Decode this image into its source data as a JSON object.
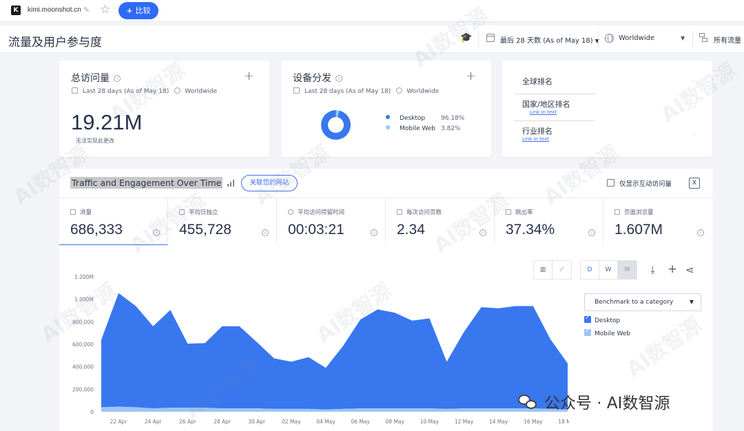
{
  "browser": {
    "site_initial": "K",
    "site_name": "kimi.moonshot.cn",
    "compare_label": "比较"
  },
  "header": {
    "title": "流量及用户参与度",
    "date_range": "最后 28 天数 (As of May 18)",
    "region": "Worldwide",
    "traffic_type": "所有流量"
  },
  "visits_card": {
    "title": "总访问量",
    "period": "Last 28 days (As of May 18)",
    "region": "Worldwide",
    "value": "19.21M",
    "note": "无法实现此更改"
  },
  "device_card": {
    "title": "设备分发",
    "period": "Last 28 days (As of May 18)",
    "region": "Worldwide",
    "desktop_label": "Desktop",
    "desktop_pct": "96.18%",
    "mobile_label": "Mobile Web",
    "mobile_pct": "3.82%",
    "desktop_share": 96.18,
    "mobile_share": 3.82,
    "desktop_color": "#3977ef",
    "mobile_color": "#8ccaf7"
  },
  "rank_card": {
    "global_rank": "全球排名",
    "country_rank": "国家/地区排名",
    "country_link": "Link in text",
    "industry_rank": "行业排名",
    "industry_link": "Link in text",
    "global_value": "-",
    "country_value": "-",
    "industry_value": "-"
  },
  "section": {
    "title": "Traffic and Engagement Over Time",
    "connect_label": "关联您的网站",
    "checkbox_label": "仅显示互动访问量",
    "excel_icon": "excel-icon"
  },
  "metrics": [
    {
      "label": "流量",
      "value": "686,333"
    },
    {
      "label": "平均日独立",
      "value": "455,728"
    },
    {
      "label": "平均访问停留时间",
      "value": "00:03:21"
    },
    {
      "label": "每次访问页数",
      "value": "2.34"
    },
    {
      "label": "跳出率",
      "value": "37.34%"
    },
    {
      "label": "页面浏览量",
      "value": "1.607M"
    }
  ],
  "toolbar": {
    "granularity": [
      "D",
      "W",
      "M"
    ],
    "granularity_selected": "M",
    "benchmark_label": "Benchmark to a category",
    "series_desktop": "Desktop",
    "series_mobile": "Mobile Web"
  },
  "chart_data": {
    "type": "area",
    "stacked": true,
    "y_ticks": [
      "0",
      "200,000",
      "400,000",
      "600,000",
      "800,000",
      "1.000M",
      "1.200M"
    ],
    "ylim": [
      0,
      1200000
    ],
    "x_tick_labels": [
      "22 Apr",
      "24 Apr",
      "26 Apr",
      "28 Apr",
      "30 Apr",
      "02 May",
      "04 May",
      "06 May",
      "08 May",
      "10 May",
      "12 May",
      "14 May",
      "16 May",
      "18 May"
    ],
    "x": [
      "21 Apr",
      "22 Apr",
      "23 Apr",
      "24 Apr",
      "25 Apr",
      "26 Apr",
      "27 Apr",
      "28 Apr",
      "29 Apr",
      "30 Apr",
      "01 May",
      "02 May",
      "03 May",
      "04 May",
      "05 May",
      "06 May",
      "07 May",
      "08 May",
      "09 May",
      "10 May",
      "11 May",
      "12 May",
      "13 May",
      "14 May",
      "15 May",
      "16 May",
      "17 May",
      "18 May"
    ],
    "series": [
      {
        "name": "Desktop",
        "color": "#3977ef",
        "values": [
          600000,
          1010000,
          900000,
          730000,
          870000,
          570000,
          575000,
          730000,
          730000,
          590000,
          450000,
          420000,
          460000,
          370000,
          560000,
          790000,
          880000,
          850000,
          780000,
          800000,
          420000,
          680000,
          900000,
          890000,
          910000,
          910000,
          620000,
          410000
        ]
      },
      {
        "name": "Mobile Web",
        "color": "#9cc5f5",
        "values": [
          40000,
          45000,
          40000,
          30000,
          35000,
          35000,
          35000,
          30000,
          30000,
          30000,
          25000,
          25000,
          25000,
          20000,
          25000,
          30000,
          30000,
          30000,
          30000,
          30000,
          25000,
          30000,
          30000,
          30000,
          30000,
          30000,
          25000,
          20000
        ]
      }
    ],
    "grid": false,
    "legend": "right"
  },
  "watermark": {
    "tile_text": "AI数智源",
    "channel_text": "公众号 · AI数智源"
  }
}
